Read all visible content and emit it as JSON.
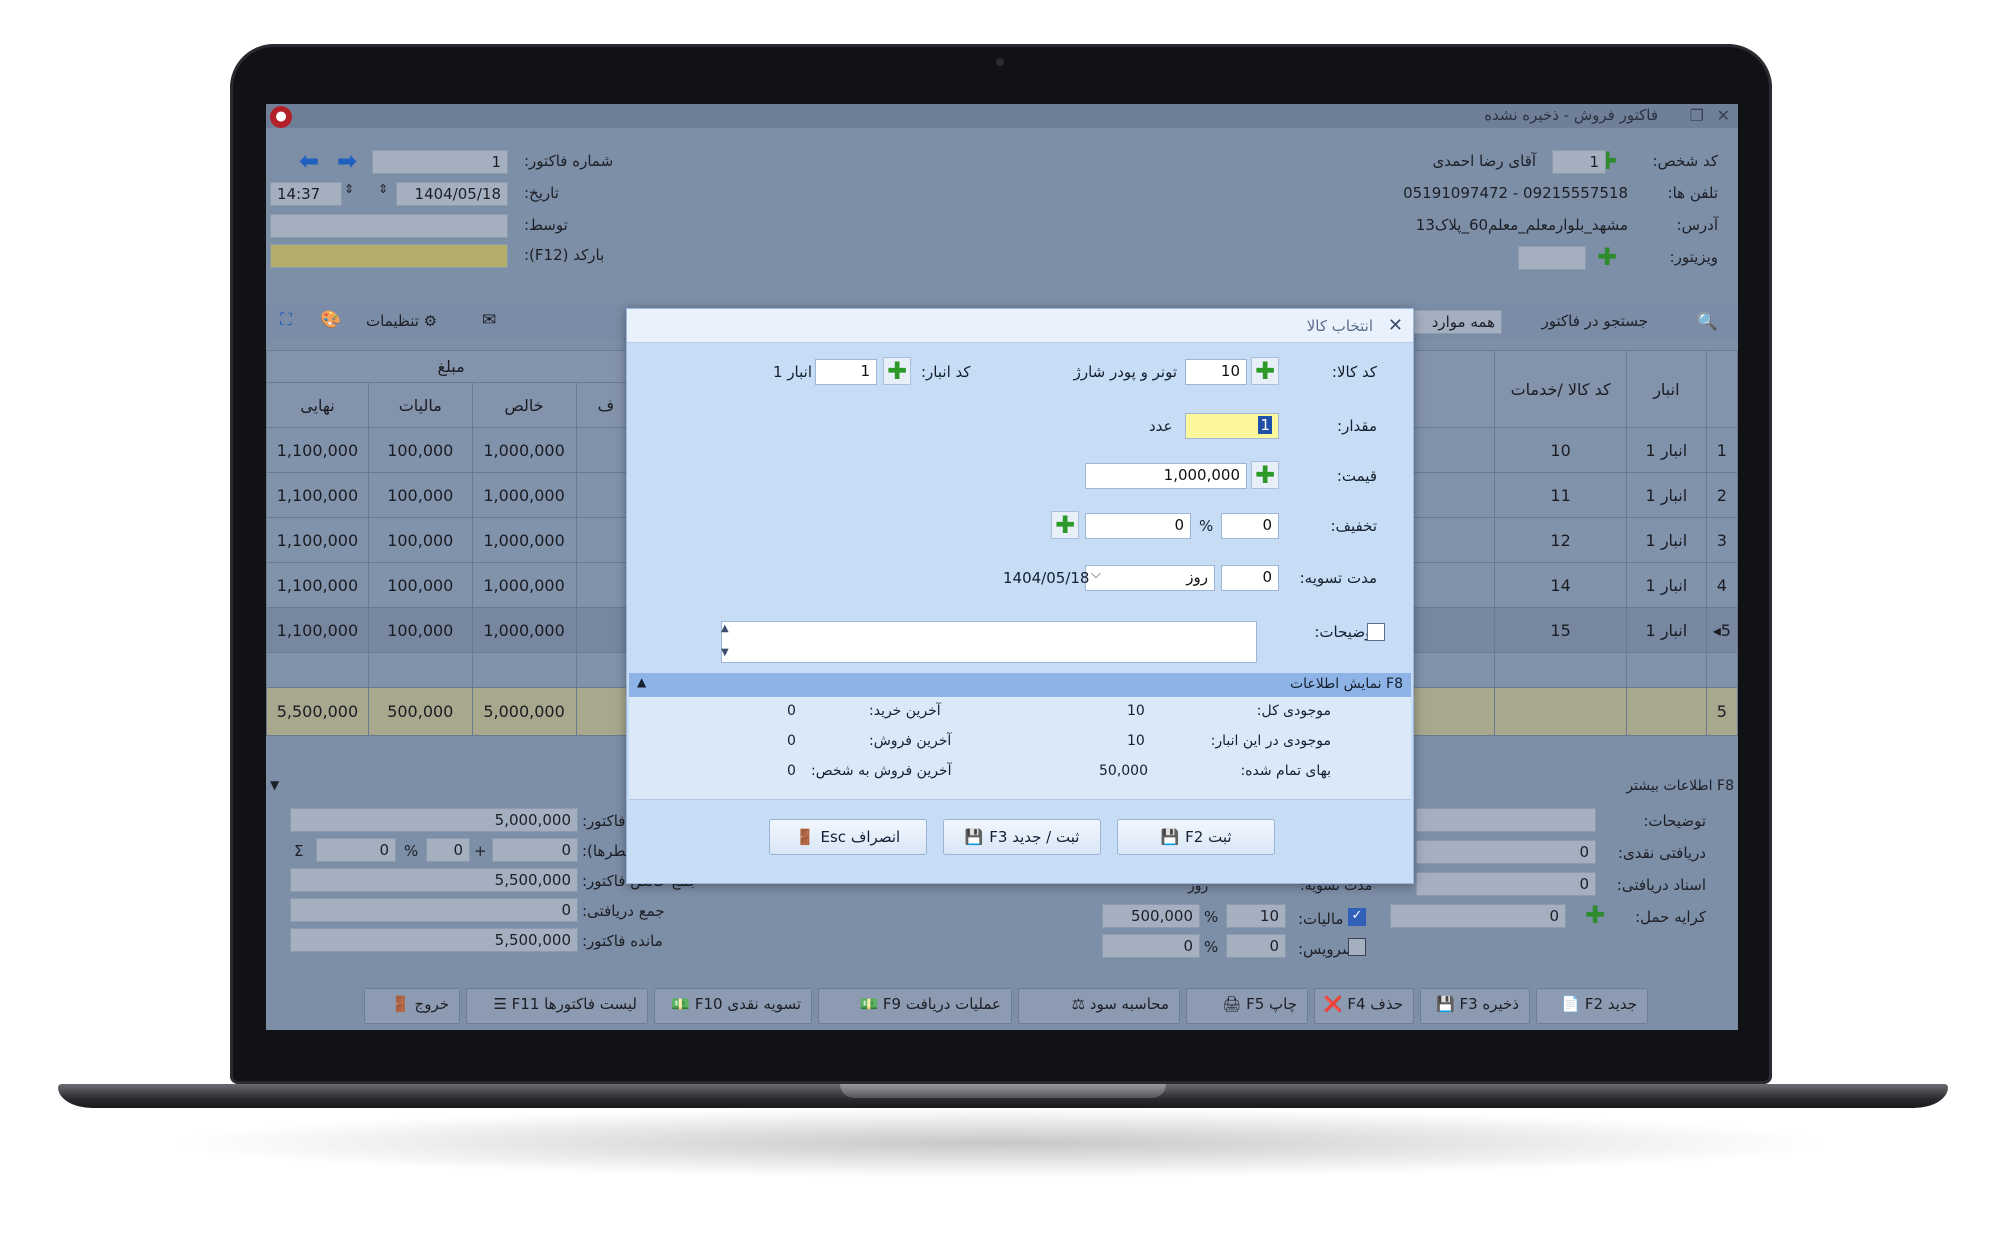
{
  "window": {
    "title": "فاکتور فروش - ذخیره نشده"
  },
  "header": {
    "customer_code_label": "کد شخص:",
    "customer_code": "1",
    "customer_name": "آقای رضا احمدی",
    "phones_label": "تلفن ها:",
    "phones": "05191097472 - 09215557518",
    "address_label": "آدرس:",
    "address": "مشهد_بلوارمعلم_معلم60_پلاک13",
    "visitor_label": "ویزیتور:",
    "invoice_no_label": "شماره فاکتور:",
    "invoice_no": "1",
    "date_label": "تاریخ:",
    "date": "1404/05/18",
    "time": "14:37",
    "by_label": "توسط:",
    "barcode_label": "بارکد (F12):"
  },
  "toolbar": {
    "search_label": "جستجو در فاکتور",
    "search_scope": "همه موارد",
    "settings_label": "تنظیمات"
  },
  "grid": {
    "amount_group_label": "مبلغ",
    "columns": {
      "warehouse": "انبار",
      "product": "کد کالا /خدمات",
      "final": "نهایی",
      "tax": "مالیات",
      "net": "خالص",
      "partial": "ف"
    },
    "rows": [
      {
        "n": "1",
        "warehouse": "انبار 1",
        "code": "10",
        "final": "1,100,000",
        "tax": "100,000",
        "net": "1,000,000"
      },
      {
        "n": "2",
        "warehouse": "انبار 1",
        "code": "11",
        "final": "1,100,000",
        "tax": "100,000",
        "net": "1,000,000"
      },
      {
        "n": "3",
        "warehouse": "انبار 1",
        "code": "12",
        "final": "1,100,000",
        "tax": "100,000",
        "net": "1,000,000"
      },
      {
        "n": "4",
        "warehouse": "انبار 1",
        "code": "14",
        "final": "1,100,000",
        "tax": "100,000",
        "net": "1,000,000"
      },
      {
        "n": "5",
        "warehouse": "انبار 1",
        "code": "15",
        "final": "1,100,000",
        "tax": "100,000",
        "net": "1,000,000"
      }
    ],
    "totals": {
      "n": "5",
      "final": "5,500,000",
      "tax": "500,000",
      "net": "5,000,000"
    }
  },
  "more_info": {
    "label": "F8 اطلاعات بیشتر",
    "notes_label": "توضیحات:",
    "cash_received_label": "دریافتی نقدی:",
    "cash_received": "0",
    "docs_received_label": "اسناد دریافتی:",
    "docs_received": "0",
    "freight_label": "کرایه حمل:",
    "freight": "0",
    "tax_label": "مالیات:",
    "tax_percent": "10",
    "tax_amount": "500,000",
    "service_label": "سرویس:",
    "service_percent": "0",
    "service_amount": "0",
    "settle_label": "مدت تسویه:",
    "settle_unit": "روز",
    "invoice_sum_label": "فاکتور:",
    "invoice_sum": "5,000,000",
    "rows_discount_label": "سطرها):",
    "rows_discount": "0",
    "discount_percent": "0",
    "discount_extra": "0",
    "net_total_label": "جمع خالص فاکتور:",
    "net_total": "5,500,000",
    "received_total_label": "جمع دریافتی:",
    "received_total": "0",
    "remaining_label": "مانده فاکتور:",
    "remaining": "5,500,000"
  },
  "footer_buttons": {
    "new": "جدید F2",
    "save": "ذخیره F3",
    "delete": "حذف F4",
    "print": "چاپ F5",
    "profit": "محاسبه سود",
    "receive_ops": "عملیات دریافت F9",
    "cash_settle": "تسویه نقدی F10",
    "invoice_list": "لیست فاکتورها F11",
    "exit": "خروج"
  },
  "dialog": {
    "title": "انتخاب کالا",
    "product_code_label": "کد کالا:",
    "product_code": "10",
    "product_name": "تونر و پودر شارژ",
    "warehouse_code_label": "کد انبار:",
    "warehouse_code": "1",
    "warehouse_name": "انبار 1",
    "quantity_label": "مقدار:",
    "quantity": "1",
    "unit": "عدد",
    "price_label": "قیمت:",
    "price": "1,000,000",
    "discount_label": "تخفیف:",
    "discount_percent": "0",
    "discount_amount": "0",
    "settle_label": "مدت تسویه:",
    "settle_days": "0",
    "settle_unit": "روز",
    "settle_date": "1404/05/18",
    "notes_label": "توضیحات:",
    "info_bar": "F8 نمایش اطلاعات",
    "info": {
      "total_stock_label": "موجودی کل:",
      "total_stock": "10",
      "last_purchase_label": "آخرین خرید:",
      "last_purchase": "0",
      "warehouse_stock_label": "موجودی در این انبار:",
      "warehouse_stock": "10",
      "last_sale_label": "آخرین فروش:",
      "last_sale": "0",
      "cost_price_label": "بهای تمام شده:",
      "cost_price": "50,000",
      "last_sale_person_label": "آخرین فروش به شخص:",
      "last_sale_person": "0"
    },
    "buttons": {
      "save": "ثبت F2",
      "save_new": "ثبت / جدید F3",
      "cancel": "انصراف Esc"
    }
  },
  "colors": {
    "dialog_bg": "#c7dcf5",
    "screen_dim": "#7d8ea7",
    "highlight_yellow": "#fbf79a",
    "plus_green": "#2e8b2e"
  }
}
